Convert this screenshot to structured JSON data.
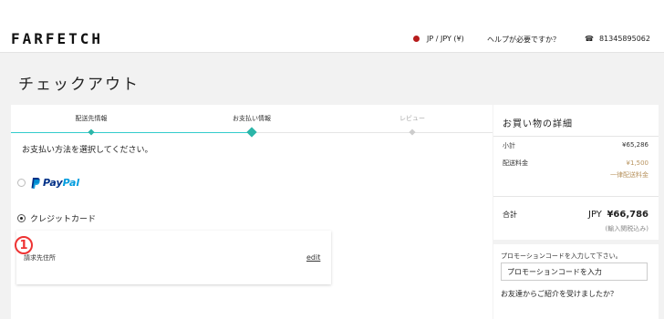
{
  "header": {
    "logo": "FARFETCH",
    "region": "JP / JPY (¥)",
    "help": "ヘルプが必要ですか？",
    "phone": "81345895062"
  },
  "page": {
    "title": "チェックアウト"
  },
  "steps": [
    {
      "label": "配送先情報",
      "state": "done"
    },
    {
      "label": "お支払い情報",
      "state": "current"
    },
    {
      "label": "レビュー",
      "state": "upcoming"
    }
  ],
  "payment": {
    "instruction": "お支払い方法を選択してください。",
    "paypal": {
      "pay": "Pay",
      "pal": "Pal",
      "selected": false
    },
    "credit_card": {
      "label": "クレジットカード",
      "selected": true
    },
    "billing_address": {
      "label": "請求先住所",
      "edit": "edit",
      "badge": "1"
    }
  },
  "summary": {
    "title": "お買い物の詳細",
    "subtotal_label": "小計",
    "subtotal_value": "¥65,286",
    "shipping_label": "配送料金",
    "shipping_value": "¥1,500",
    "shipping_note": "一律配送料金",
    "total_label": "合計",
    "total_currency": "JPY",
    "total_value": "¥66,786",
    "tax_note": "(輸入関税込み)"
  },
  "promo": {
    "label": "プロモーションコードを入力して下さい。",
    "placeholder": "プロモーションコードを入力",
    "referral": "お友達からご紹介を受けましたか？"
  },
  "colors": {
    "accent": "#2bb5a8",
    "step_line": "#33cccc",
    "gold": "#b89460",
    "badge": "#ee3333",
    "paypal_dark": "#003087",
    "paypal_light": "#009cde",
    "region_dot": "#b71c1c"
  }
}
